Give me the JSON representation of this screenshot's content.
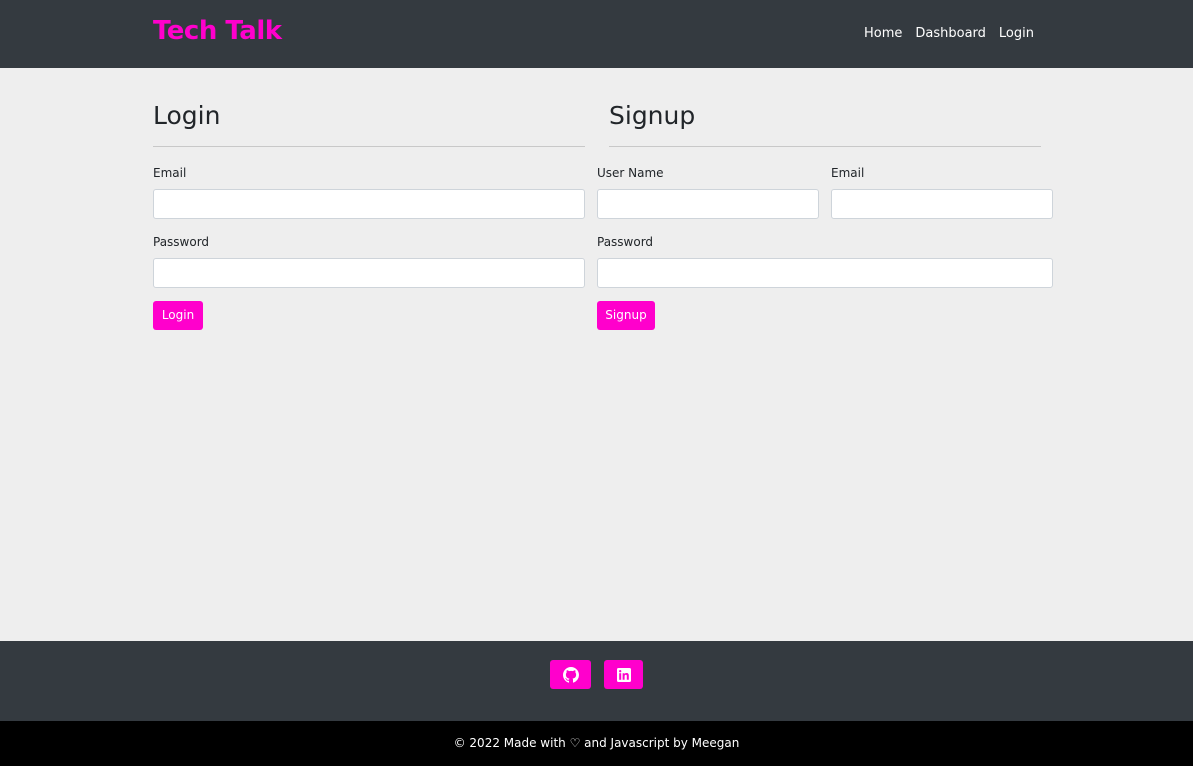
{
  "navbar": {
    "brand": "Tech Talk",
    "links": [
      "Home",
      "Dashboard",
      "Login"
    ]
  },
  "login": {
    "title": "Login",
    "email_label": "Email",
    "email_value": "",
    "password_label": "Password",
    "password_value": "",
    "button_label": "Login"
  },
  "signup": {
    "title": "Signup",
    "username_label": "User Name",
    "username_value": "",
    "email_label": "Email",
    "email_value": "",
    "password_label": "Password",
    "password_value": "",
    "button_label": "Signup"
  },
  "footer": {
    "social": [
      {
        "icon": "github-icon"
      },
      {
        "icon": "linkedin-icon"
      }
    ],
    "copyright": "© 2022 Made with ♡ and Javascript by Meegan"
  },
  "colors": {
    "accent": "#ff00cc",
    "nav_bg": "#343a40",
    "page_bg": "#eeeeee",
    "bottom_bar": "#000000"
  }
}
